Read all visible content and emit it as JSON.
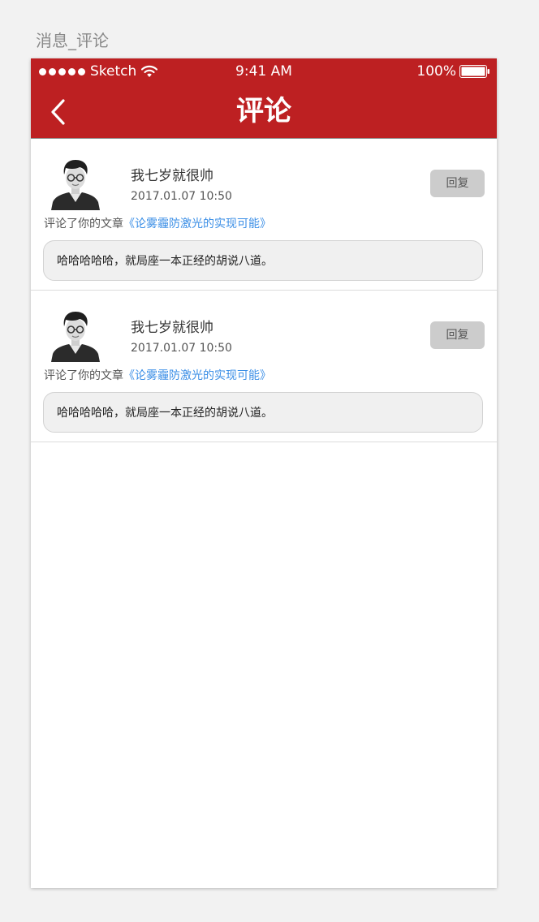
{
  "artboard": {
    "title": "消息_评论"
  },
  "statusbar": {
    "carrier": "Sketch",
    "time": "9:41 AM",
    "battery": "100%"
  },
  "navbar": {
    "title": "评论"
  },
  "comments": [
    {
      "username": "我七岁就很帅",
      "time": "2017.01.07 10:50",
      "reply_label": "回复",
      "action_prefix": "评论了你的文章",
      "article_title": "《论雾霾防激光的实现可能》",
      "content": "哈哈哈哈哈，就局座一本正经的胡说八道。"
    },
    {
      "username": "我七岁就很帅",
      "time": "2017.01.07 10:50",
      "reply_label": "回复",
      "action_prefix": "评论了你的文章",
      "article_title": "《论雾霾防激光的实现可能》",
      "content": "哈哈哈哈哈，就局座一本正经的胡说八道。"
    }
  ],
  "colors": {
    "brand_red": "#bd2022",
    "link_blue": "#3a8ee6",
    "reply_bg": "#cccccc"
  },
  "icons": [
    "signal-dots-icon",
    "wifi-icon",
    "battery-icon",
    "back-chevron-icon",
    "avatar-icon"
  ]
}
